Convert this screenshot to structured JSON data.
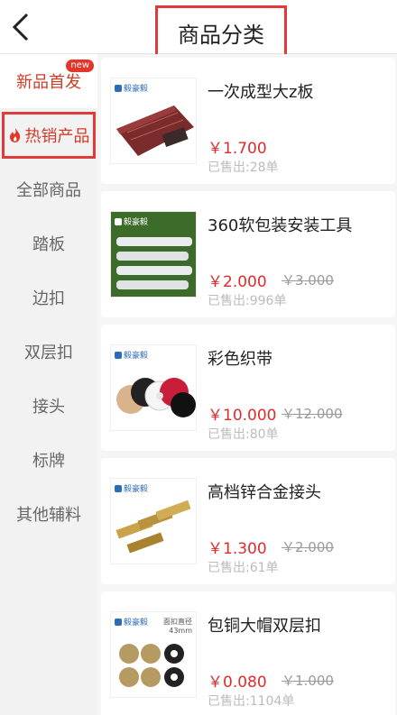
{
  "header": {
    "title": "商品分类"
  },
  "sidebar": {
    "new_badge": "new",
    "items": [
      {
        "label": "新品首发"
      },
      {
        "label": "热销产品"
      },
      {
        "label": "全部商品"
      },
      {
        "label": "踏板"
      },
      {
        "label": "边扣"
      },
      {
        "label": "双层扣"
      },
      {
        "label": "接头"
      },
      {
        "label": "标牌"
      },
      {
        "label": "其他辅料"
      }
    ]
  },
  "products": [
    {
      "name": "一次成型大z板",
      "price": "￥1.700",
      "old_price": "",
      "sold": "已售出:28单",
      "brand": "毅豪毅",
      "thumb_note": ""
    },
    {
      "name": "360软包装安装工具",
      "price": "￥2.000",
      "old_price": "￥3.000",
      "sold": "已售出:996单",
      "brand": "毅豪毅",
      "thumb_note": ""
    },
    {
      "name": "彩色织带",
      "price": "￥10.000",
      "old_price": "￥12.000",
      "sold": "已售出:80单",
      "brand": "毅豪毅",
      "thumb_note": ""
    },
    {
      "name": "高档锌合金接头",
      "price": "￥1.300",
      "old_price": "￥2.000",
      "sold": "已售出:61单",
      "brand": "毅豪毅",
      "thumb_note": ""
    },
    {
      "name": "包铜大帽双层扣",
      "price": "￥0.080",
      "old_price": "￥1.000",
      "sold": "已售出:1104单",
      "brand": "毅豪毅",
      "thumb_note": "面扣直径\n43mm"
    }
  ],
  "colors": {
    "accent": "#d13b28",
    "price": "#e02b2b",
    "highlight_border": "#e03a3a"
  }
}
